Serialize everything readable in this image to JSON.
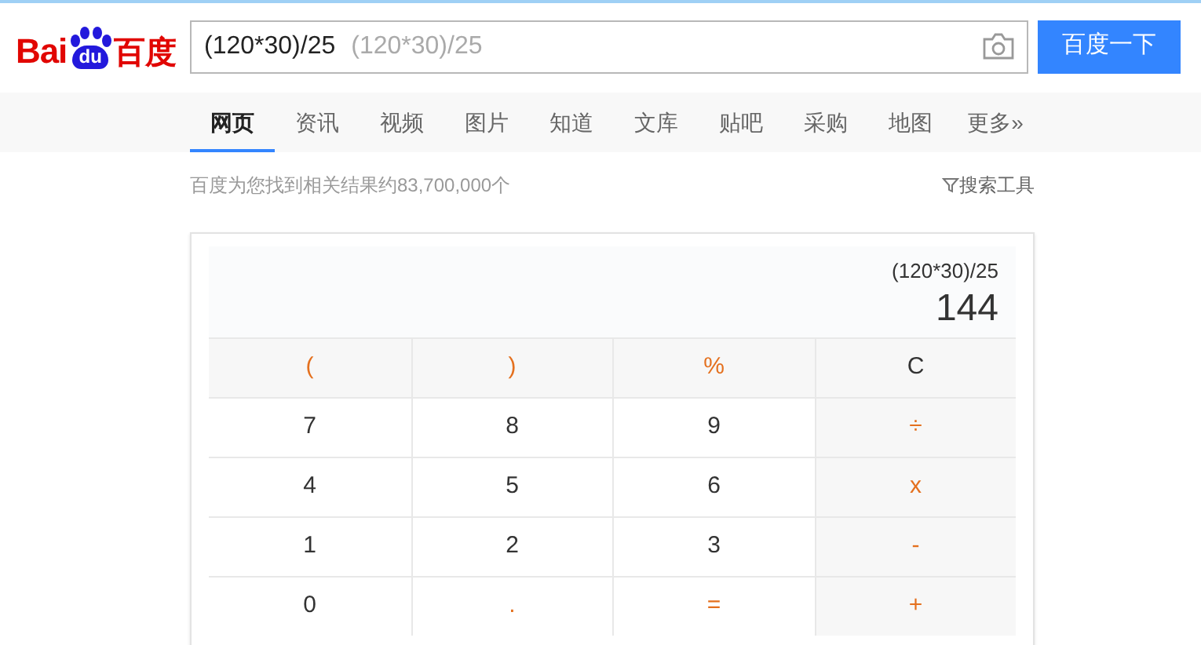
{
  "logo": {
    "parts": [
      "Bai",
      "du",
      "百度"
    ]
  },
  "search": {
    "value": "(120*30)/25",
    "suggestion": "(120*30)/25",
    "button": "百度一下"
  },
  "tabs": [
    {
      "label": "网页",
      "selected": true
    },
    {
      "label": "资讯",
      "selected": false
    },
    {
      "label": "视频",
      "selected": false
    },
    {
      "label": "图片",
      "selected": false
    },
    {
      "label": "知道",
      "selected": false
    },
    {
      "label": "文库",
      "selected": false
    },
    {
      "label": "贴吧",
      "selected": false
    },
    {
      "label": "采购",
      "selected": false
    },
    {
      "label": "地图",
      "selected": false
    },
    {
      "label": "更多»",
      "selected": false
    }
  ],
  "result_count": "百度为您找到相关结果约83,700,000个",
  "search_tools": "搜索工具",
  "calculator": {
    "expression": "(120*30)/25",
    "result": "144",
    "keys": [
      [
        {
          "label": "(",
          "kind": "operator"
        },
        {
          "label": ")",
          "kind": "operator"
        },
        {
          "label": "%",
          "kind": "operator"
        },
        {
          "label": "C",
          "kind": "clear"
        }
      ],
      [
        {
          "label": "7",
          "kind": "number"
        },
        {
          "label": "8",
          "kind": "number"
        },
        {
          "label": "9",
          "kind": "number"
        },
        {
          "label": "÷",
          "kind": "operator"
        }
      ],
      [
        {
          "label": "4",
          "kind": "number"
        },
        {
          "label": "5",
          "kind": "number"
        },
        {
          "label": "6",
          "kind": "number"
        },
        {
          "label": "x",
          "kind": "operator"
        }
      ],
      [
        {
          "label": "1",
          "kind": "number"
        },
        {
          "label": "2",
          "kind": "number"
        },
        {
          "label": "3",
          "kind": "number"
        },
        {
          "label": "-",
          "kind": "operator"
        }
      ],
      [
        {
          "label": "0",
          "kind": "number"
        },
        {
          "label": ".",
          "kind": "operator"
        },
        {
          "label": "=",
          "kind": "operator"
        },
        {
          "label": "+",
          "kind": "operator"
        }
      ]
    ]
  }
}
